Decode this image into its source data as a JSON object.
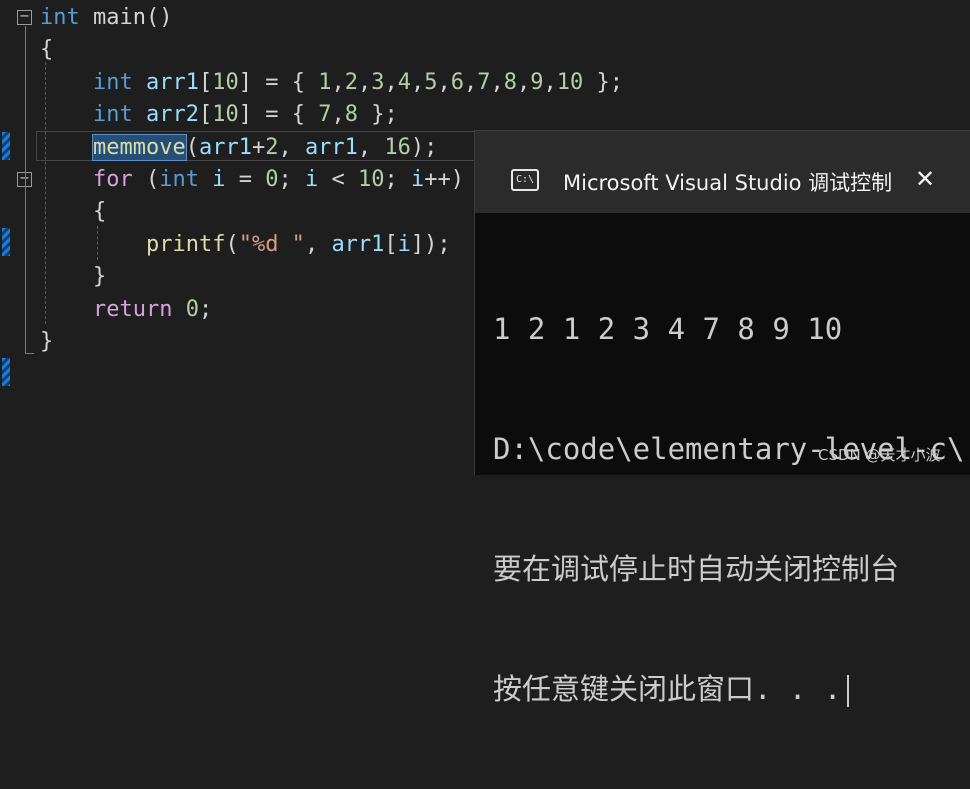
{
  "editor": {
    "fold_open_glyph": "−",
    "lines": [
      [
        [
          "kw",
          "int"
        ],
        [
          "",
          " main()"
        ]
      ],
      [
        [
          "",
          "{"
        ]
      ],
      [
        [
          "",
          "    "
        ],
        [
          "kw",
          "int"
        ],
        [
          "",
          " "
        ],
        [
          "id",
          "arr1"
        ],
        [
          "",
          "["
        ],
        [
          "num",
          "10"
        ],
        [
          "",
          "] = { "
        ],
        [
          "num",
          "1"
        ],
        [
          "",
          ","
        ],
        [
          "num",
          "2"
        ],
        [
          "",
          ","
        ],
        [
          "num",
          "3"
        ],
        [
          "",
          ","
        ],
        [
          "num",
          "4"
        ],
        [
          "",
          ","
        ],
        [
          "num",
          "5"
        ],
        [
          "",
          ","
        ],
        [
          "num",
          "6"
        ],
        [
          "",
          ","
        ],
        [
          "num",
          "7"
        ],
        [
          "",
          ","
        ],
        [
          "num",
          "8"
        ],
        [
          "",
          ","
        ],
        [
          "num",
          "9"
        ],
        [
          "",
          ","
        ],
        [
          "num",
          "10"
        ],
        [
          "",
          " };"
        ]
      ],
      [
        [
          "",
          "    "
        ],
        [
          "kw",
          "int"
        ],
        [
          "",
          " "
        ],
        [
          "id",
          "arr2"
        ],
        [
          "",
          "["
        ],
        [
          "num",
          "10"
        ],
        [
          "",
          "] = { "
        ],
        [
          "num",
          "7"
        ],
        [
          "",
          ","
        ],
        [
          "num",
          "8"
        ],
        [
          "",
          " };"
        ]
      ],
      [
        [
          "",
          "    "
        ],
        [
          "fn sel",
          "memmove"
        ],
        [
          "",
          "("
        ],
        [
          "id",
          "arr1"
        ],
        [
          "",
          "+"
        ],
        [
          "num",
          "2"
        ],
        [
          "",
          ", "
        ],
        [
          "id",
          "arr1"
        ],
        [
          "",
          ", "
        ],
        [
          "num",
          "16"
        ],
        [
          "",
          ");"
        ]
      ],
      [
        [
          "",
          "    "
        ],
        [
          "kw2",
          "for"
        ],
        [
          "",
          " ("
        ],
        [
          "kw",
          "int"
        ],
        [
          "",
          " "
        ],
        [
          "id",
          "i"
        ],
        [
          "",
          " = "
        ],
        [
          "num",
          "0"
        ],
        [
          "",
          "; "
        ],
        [
          "id",
          "i"
        ],
        [
          "",
          " < "
        ],
        [
          "num",
          "10"
        ],
        [
          "",
          "; "
        ],
        [
          "id",
          "i"
        ],
        [
          "",
          "++)"
        ]
      ],
      [
        [
          "",
          "    {"
        ]
      ],
      [
        [
          "",
          "        "
        ],
        [
          "fn",
          "printf"
        ],
        [
          "",
          "("
        ],
        [
          "str",
          "\"%d \""
        ],
        [
          "",
          ", "
        ],
        [
          "id",
          "arr1"
        ],
        [
          "",
          "["
        ],
        [
          "id",
          "i"
        ],
        [
          "",
          "]);"
        ]
      ],
      [
        [
          "",
          "    }"
        ]
      ],
      [
        [
          "",
          "    "
        ],
        [
          "kw2",
          "return"
        ],
        [
          "",
          " "
        ],
        [
          "num",
          "0"
        ],
        [
          "",
          ";"
        ]
      ],
      [
        [
          "",
          "}"
        ]
      ]
    ]
  },
  "console": {
    "icon_label": "C:\\",
    "title": "Microsoft Visual Studio 调试控制台",
    "close_glyph": "✕",
    "output_lines": [
      "1 2 1 2 3 4 7 8 9 10",
      "D:\\code\\elementary-level-c\\",
      "要在调试停止时自动关闭控制台",
      "按任意键关闭此窗口. . ."
    ]
  },
  "watermark": "CSDN @天才小波",
  "colors": {
    "keyword": "#569cd6",
    "control": "#d8a0df",
    "number": "#b5cea8",
    "function": "#dcdcaa",
    "string": "#d69d85",
    "identifier": "#9cdcfe"
  }
}
